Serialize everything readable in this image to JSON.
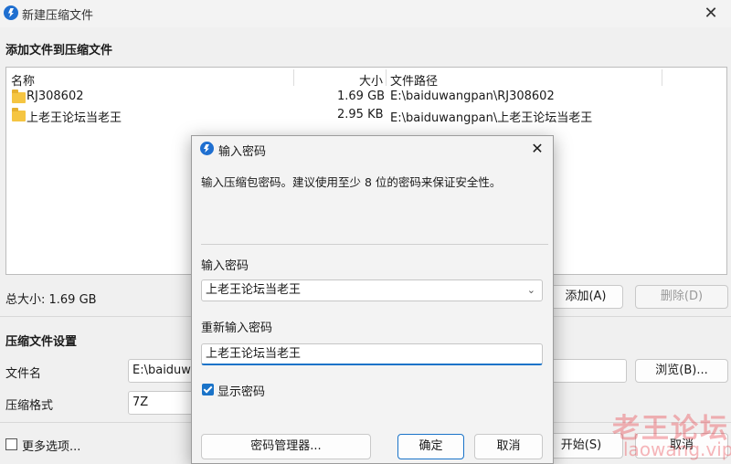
{
  "window": {
    "title": "新建压缩文件",
    "close_glyph": "✕"
  },
  "section_add_title": "添加文件到压缩文件",
  "file_list": {
    "headers": {
      "name": "名称",
      "size": "大小",
      "path": "文件路径"
    },
    "rows": [
      {
        "name": "RJ308602",
        "size": "1.69 GB",
        "path": "E:\\baiduwangpan\\RJ308602",
        "icon": "folder-icon"
      },
      {
        "name": "上老王论坛当老王",
        "size": "2.95 KB",
        "path": "E:\\baiduwangpan\\上老王论坛当老王",
        "icon": "folder-icon"
      }
    ]
  },
  "total_size": "总大小: 1.69 GB",
  "buttons": {
    "add": "添加(A)",
    "delete": "删除(D)",
    "browse": "浏览(B)...",
    "start": "开始(S)",
    "cancel": "取消"
  },
  "settings": {
    "title": "压缩文件设置",
    "filename_label": "文件名",
    "filename_value": "E:\\baiduw",
    "format_label": "压缩格式",
    "format_value": "7Z",
    "more_options": "更多选项..."
  },
  "dialog": {
    "title": "输入密码",
    "close_glyph": "✕",
    "description": "输入压缩包密码。建议使用至少 8 位的密码来保证安全性。",
    "password_label": "输入密码",
    "password_value": "上老王论坛当老王",
    "reenter_label": "重新输入密码",
    "reenter_value": "上老王论坛当老王",
    "show_password": "显示密码",
    "show_password_checked": true,
    "manager_button": "密码管理器...",
    "ok_button": "确定",
    "cancel_button": "取消"
  },
  "watermark": {
    "line1": "老王论坛",
    "line2": "laowang.vip"
  },
  "colors": {
    "accent": "#1a73c8",
    "watermark": "#e8323c"
  }
}
